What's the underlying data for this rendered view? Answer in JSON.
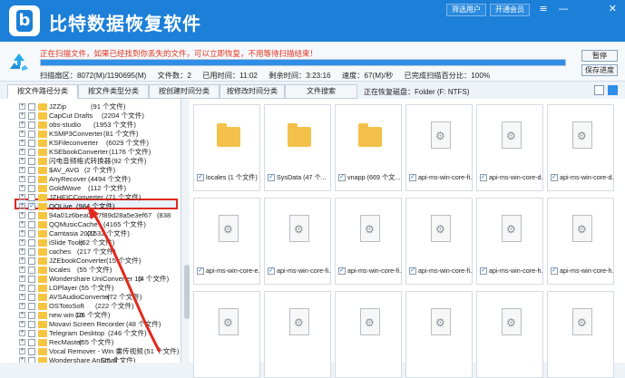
{
  "app": {
    "title": "比特数据恢复软件",
    "brand_color": "#1c7fd8",
    "logo_letter": "b",
    "buttons": [
      "筛选用户",
      "开通会员"
    ],
    "win_controls": [
      "≡",
      "—",
      "✕"
    ]
  },
  "scan": {
    "warning": "正在扫描文件，如果已经找到你丢失的文件，可以立即恢复，不用等待扫描结束！",
    "progress_percent": 100,
    "scanned_label": "扫描扇区：",
    "scanned_value": "8072(M)/1190695(M)",
    "files_label": "文件数：",
    "files_value": "2",
    "time_used_label": "已用时间：",
    "time_used_value": "11:02",
    "time_left_label": "剩余时间：",
    "time_left_value": "3:23:16",
    "speed_label": "速度：",
    "speed_value": "67(M)/秒",
    "progress_label": "已完成扫描百分比：",
    "progress_value": "100%",
    "pause_label": "暂停",
    "save_label": "保存进度"
  },
  "tabs": [
    "按文件路径分类",
    "按文件类型分类",
    "按创建时间分类",
    "按修改时间分类",
    "文件搜索"
  ],
  "partition": "正在恢复磁盘：Folder (F: NTFS)",
  "tree": [
    {
      "name": "JZZip",
      "count": "(91 个文件)"
    },
    {
      "name": "CapCut Drafts",
      "count": "(2204 个文件)"
    },
    {
      "name": "obs-studio",
      "count": "(1953 个文件)"
    },
    {
      "name": "KSMP3Converter",
      "count": "(81 个文件)"
    },
    {
      "name": "KSFileconverter",
      "count": "(6029 个文件)"
    },
    {
      "name": "KSEbookConverter",
      "count": "(1176 个文件)"
    },
    {
      "name": "闪电音频格式转换器",
      "count": "(92 个文件)"
    },
    {
      "name": "$AV_AVG",
      "count": "(2 个文件)"
    },
    {
      "name": "AnyRecover",
      "count": "(4494 个文件)"
    },
    {
      "name": "GoldWave",
      "count": "(112 个文件)"
    },
    {
      "name": "JZHEICConverter",
      "count": "(71 个文件)"
    },
    {
      "name": "QQLive",
      "count": "(984 个文件)"
    },
    {
      "name": "94a01z6bea04c7f89d28a5e3ef67",
      "count": "(838"
    },
    {
      "name": "QQMusicCache",
      "count": "(4165 个文件)"
    },
    {
      "name": "Camtasia 2022",
      "count": "(1532 个文件)"
    },
    {
      "name": "iSlide Tools",
      "count": "(62 个文件)"
    },
    {
      "name": "caches",
      "count": "(217 个文件)"
    },
    {
      "name": "JZEbookConverter",
      "count": "(15 个文件)"
    },
    {
      "name": "locales",
      "count": "(55 个文件)"
    },
    {
      "name": "Wondershare UniConverter 15",
      "count": "(4 个文件)"
    },
    {
      "name": "LDPlayer",
      "count": "(55 个文件)"
    },
    {
      "name": "AVSAudioConverter",
      "count": "(72 个文件)"
    },
    {
      "name": "OSTotoSoft",
      "count": "(222 个文件)"
    },
    {
      "name": "new win 10",
      "count": "(26 个文件)"
    },
    {
      "name": "Movavi Screen Recorder",
      "count": "(48 个文件)"
    },
    {
      "name": "Telegram Desktop",
      "count": "(246 个文件)"
    },
    {
      "name": "RecMaster",
      "count": "(55 个文件)"
    },
    {
      "name": "Vocal Remover - Win 畫传视频",
      "count": "(51 个文件)"
    },
    {
      "name": "Wondershare AnSmall",
      "count": "(25 个文件)"
    }
  ],
  "selected_index": 11,
  "tiles": [
    {
      "label": "locales (1 个文件)",
      "kind": "folder"
    },
    {
      "label": "SysData (47 个...",
      "kind": "folder"
    },
    {
      "label": "vnapp (669 个文...",
      "kind": "folder"
    },
    {
      "label": "api-ms-win-core-fi...",
      "kind": "doc"
    },
    {
      "label": "api-ms-win-core-d...",
      "kind": "doc"
    },
    {
      "label": "api-ms-win-core-d...",
      "kind": "doc"
    },
    {
      "label": "api-ms-win-core-e...",
      "kind": "doc"
    },
    {
      "label": "api-ms-win-core-fi...",
      "kind": "doc"
    },
    {
      "label": "api-ms-win-core-fi...",
      "kind": "doc"
    },
    {
      "label": "api-ms-win-core-fi...",
      "kind": "doc"
    },
    {
      "label": "api-ms-win-core-h...",
      "kind": "doc"
    },
    {
      "label": "api-ms-win-core-h...",
      "kind": "doc"
    },
    {
      "label": "",
      "kind": "doc"
    },
    {
      "label": "",
      "kind": "doc"
    },
    {
      "label": "",
      "kind": "doc"
    },
    {
      "label": "",
      "kind": "doc"
    },
    {
      "label": "",
      "kind": "doc"
    },
    {
      "label": "",
      "kind": "doc"
    }
  ],
  "annotation_color": "#e02a1e"
}
